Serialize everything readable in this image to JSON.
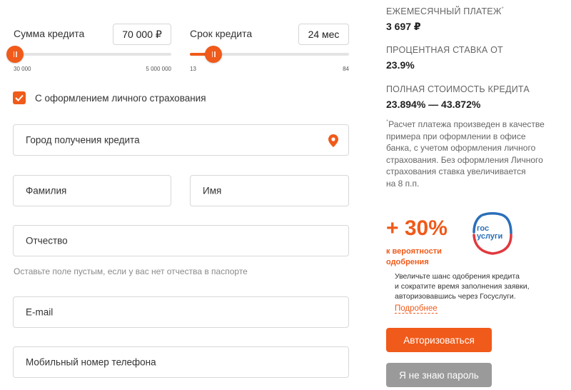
{
  "loan": {
    "amount_label": "Сумма кредита",
    "amount_value": "70 000 ₽",
    "amount_min": "30 000",
    "amount_max": "5 000 000",
    "amount_fill_fraction": 0.01,
    "term_label": "Срок кредита",
    "term_value": "24 мес",
    "term_min": "13",
    "term_max": "84",
    "term_fill_fraction": 0.15
  },
  "insurance": {
    "checked": true,
    "label": "С оформлением личного страхования"
  },
  "form": {
    "city_label": "Город получения кредита",
    "lastname_label": "Фамилия",
    "firstname_label": "Имя",
    "middlename_label": "Отчество",
    "middlename_hint": "Оставьте поле пустым, если у вас нет отчества в паспорте",
    "email_label": "E-mail",
    "phone_label": "Мобильный номер телефона"
  },
  "summary": {
    "monthly_label": "ЕЖЕМЕСЯЧНЫЙ ПЛАТЕЖ",
    "monthly_mark": "*",
    "monthly_value": "3 697 ₽",
    "rate_label": "ПРОЦЕНТНАЯ СТАВКА ОТ",
    "rate_value": "23.9%",
    "cost_label": "ПОЛНАЯ СТОИМОСТЬ КРЕДИТА",
    "cost_value": "23.894% — 43.872%",
    "note_mark": "*",
    "note_lines": [
      "Расчет платежа произведен в качестве",
      "примера при оформлении в офисе",
      "банка, с учетом оформления личного",
      "страхования. Без оформления Личного",
      "страхования ставка увеличивается",
      "на 8 п.п."
    ]
  },
  "gosuslugi": {
    "big": "+ 30%",
    "sub_line1": "к вероятности",
    "sub_line2": "одобрения",
    "logo_top": "гос",
    "logo_bottom": "услуги",
    "text_lines": [
      "Увеличьте шанс одобрения кредита",
      "и сократите время заполнения заявки,",
      "авторизовавшись через Госуслуги."
    ],
    "more_link": "Подробнее",
    "authorize_button": "Авторизоваться",
    "no_password_button": "Я не знаю пароль"
  },
  "colors": {
    "accent": "#f05a1a",
    "gosuslugi_blue": "#2a6fb8",
    "gosuslugi_red": "#e0393e",
    "grey_button": "#9a9a9a"
  }
}
